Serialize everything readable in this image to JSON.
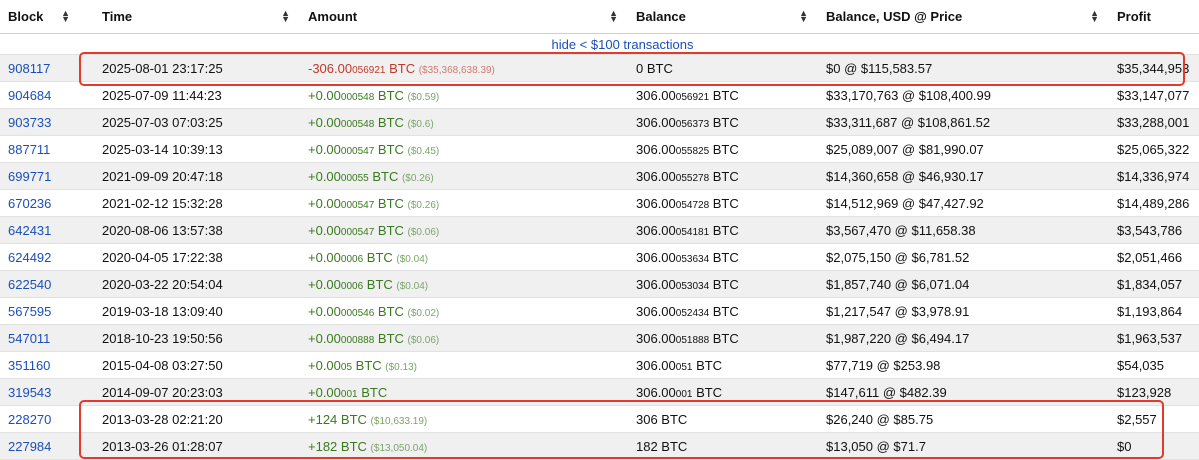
{
  "headers": {
    "block": "Block",
    "time": "Time",
    "amount": "Amount",
    "balance": "Balance",
    "balance_usd": "Balance, USD @ Price",
    "profit": "Profit"
  },
  "hide_link": "hide < $100 transactions",
  "highlight_color": "#e03b2c",
  "rows": [
    {
      "block": "908117",
      "time": "2025-08-01 23:17:25",
      "amount_main": "-306.00",
      "amount_small": "056921",
      "amount_unit": " BTC",
      "amount_usd": "($35,368,638.39)",
      "sign": "neg",
      "balance_main": "0 BTC",
      "balance_small": "",
      "balance_unit": "",
      "usd_price": "$0 @ $115,583.57",
      "profit": "$35,344,953"
    },
    {
      "block": "904684",
      "time": "2025-07-09 11:44:23",
      "amount_main": "+0.00",
      "amount_small": "000548",
      "amount_unit": " BTC",
      "amount_usd": "($0.59)",
      "sign": "pos",
      "balance_main": "306.00",
      "balance_small": "056921",
      "balance_unit": " BTC",
      "usd_price": "$33,170,763 @ $108,400.99",
      "profit": "$33,147,077"
    },
    {
      "block": "903733",
      "time": "2025-07-03 07:03:25",
      "amount_main": "+0.00",
      "amount_small": "000548",
      "amount_unit": " BTC",
      "amount_usd": "($0.6)",
      "sign": "pos",
      "balance_main": "306.00",
      "balance_small": "056373",
      "balance_unit": " BTC",
      "usd_price": "$33,311,687 @ $108,861.52",
      "profit": "$33,288,001"
    },
    {
      "block": "887711",
      "time": "2025-03-14 10:39:13",
      "amount_main": "+0.00",
      "amount_small": "000547",
      "amount_unit": " BTC",
      "amount_usd": "($0.45)",
      "sign": "pos",
      "balance_main": "306.00",
      "balance_small": "055825",
      "balance_unit": " BTC",
      "usd_price": "$25,089,007 @ $81,990.07",
      "profit": "$25,065,322"
    },
    {
      "block": "699771",
      "time": "2021-09-09 20:47:18",
      "amount_main": "+0.00",
      "amount_small": "00055",
      "amount_unit": " BTC",
      "amount_usd": "($0.26)",
      "sign": "pos",
      "balance_main": "306.00",
      "balance_small": "055278",
      "balance_unit": " BTC",
      "usd_price": "$14,360,658 @ $46,930.17",
      "profit": "$14,336,974"
    },
    {
      "block": "670236",
      "time": "2021-02-12 15:32:28",
      "amount_main": "+0.00",
      "amount_small": "000547",
      "amount_unit": " BTC",
      "amount_usd": "($0.26)",
      "sign": "pos",
      "balance_main": "306.00",
      "balance_small": "054728",
      "balance_unit": " BTC",
      "usd_price": "$14,512,969 @ $47,427.92",
      "profit": "$14,489,286"
    },
    {
      "block": "642431",
      "time": "2020-08-06 13:57:38",
      "amount_main": "+0.00",
      "amount_small": "000547",
      "amount_unit": " BTC",
      "amount_usd": "($0.06)",
      "sign": "pos",
      "balance_main": "306.00",
      "balance_small": "054181",
      "balance_unit": " BTC",
      "usd_price": "$3,567,470 @ $11,658.38",
      "profit": "$3,543,786"
    },
    {
      "block": "624492",
      "time": "2020-04-05 17:22:38",
      "amount_main": "+0.00",
      "amount_small": "0006",
      "amount_unit": " BTC",
      "amount_usd": "($0.04)",
      "sign": "pos",
      "balance_main": "306.00",
      "balance_small": "053634",
      "balance_unit": " BTC",
      "usd_price": "$2,075,150 @ $6,781.52",
      "profit": "$2,051,466"
    },
    {
      "block": "622540",
      "time": "2020-03-22 20:54:04",
      "amount_main": "+0.00",
      "amount_small": "0006",
      "amount_unit": " BTC",
      "amount_usd": "($0.04)",
      "sign": "pos",
      "balance_main": "306.00",
      "balance_small": "053034",
      "balance_unit": " BTC",
      "usd_price": "$1,857,740 @ $6,071.04",
      "profit": "$1,834,057"
    },
    {
      "block": "567595",
      "time": "2019-03-18 13:09:40",
      "amount_main": "+0.00",
      "amount_small": "000546",
      "amount_unit": " BTC",
      "amount_usd": "($0.02)",
      "sign": "pos",
      "balance_main": "306.00",
      "balance_small": "052434",
      "balance_unit": " BTC",
      "usd_price": "$1,217,547 @ $3,978.91",
      "profit": "$1,193,864"
    },
    {
      "block": "547011",
      "time": "2018-10-23 19:50:56",
      "amount_main": "+0.00",
      "amount_small": "000888",
      "amount_unit": " BTC",
      "amount_usd": "($0.06)",
      "sign": "pos",
      "balance_main": "306.00",
      "balance_small": "051888",
      "balance_unit": " BTC",
      "usd_price": "$1,987,220 @ $6,494.17",
      "profit": "$1,963,537"
    },
    {
      "block": "351160",
      "time": "2015-04-08 03:27:50",
      "amount_main": "+0.00",
      "amount_small": "05",
      "amount_unit": " BTC",
      "amount_usd": "($0.13)",
      "sign": "pos",
      "balance_main": "306.00",
      "balance_small": "051",
      "balance_unit": " BTC",
      "usd_price": "$77,719 @ $253.98",
      "profit": "$54,035"
    },
    {
      "block": "319543",
      "time": "2014-09-07 20:23:03",
      "amount_main": "+0.00",
      "amount_small": "001",
      "amount_unit": " BTC",
      "amount_usd": "",
      "sign": "pos",
      "balance_main": "306.00",
      "balance_small": "001",
      "balance_unit": " BTC",
      "usd_price": "$147,611 @ $482.39",
      "profit": "$123,928"
    },
    {
      "block": "228270",
      "time": "2013-03-28 02:21:20",
      "amount_main": "+124",
      "amount_small": "",
      "amount_unit": " BTC",
      "amount_usd": "($10,633.19)",
      "sign": "pos",
      "balance_main": "306 BTC",
      "balance_small": "",
      "balance_unit": "",
      "usd_price": "$26,240 @ $85.75",
      "profit": "$2,557"
    },
    {
      "block": "227984",
      "time": "2013-03-26 01:28:07",
      "amount_main": "+182",
      "amount_small": "",
      "amount_unit": " BTC",
      "amount_usd": "($13,050.04)",
      "sign": "pos",
      "balance_main": "182 BTC",
      "balance_small": "",
      "balance_unit": "",
      "usd_price": "$13,050 @ $71.7",
      "profit": "$0"
    }
  ]
}
